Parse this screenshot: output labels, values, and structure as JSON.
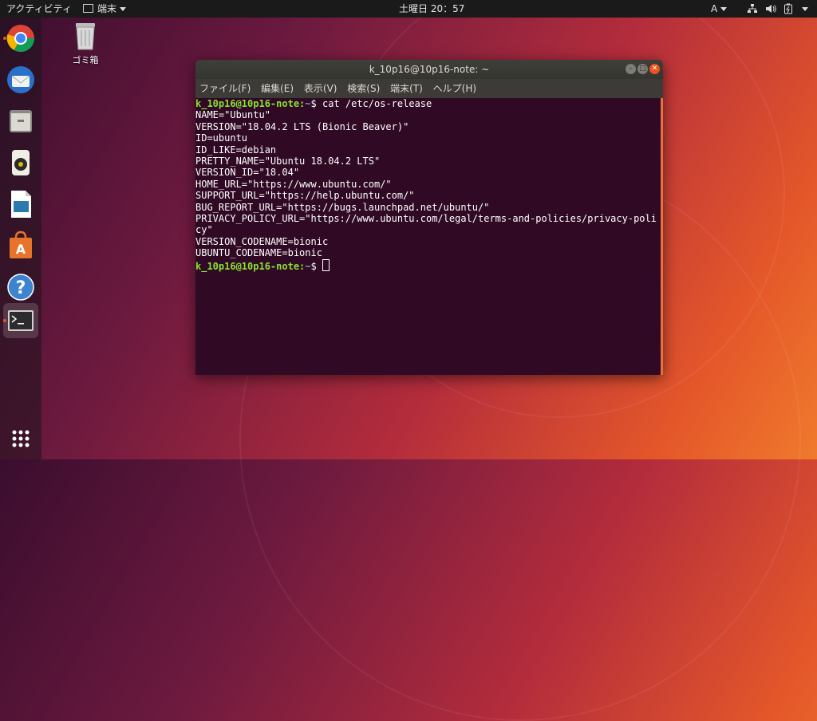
{
  "topbar": {
    "activities": "アクティビティ",
    "app_menu": "端末",
    "clock": "土曜日 20：57",
    "input_method": "A"
  },
  "desktop": {
    "trash_label": "ゴミ箱"
  },
  "dock": {
    "items": [
      "chrome-icon",
      "thunderbird-icon",
      "files-icon",
      "rhythmbox-icon",
      "libreoffice-writer-icon",
      "ubuntu-software-icon",
      "help-icon",
      "terminal-icon"
    ],
    "show_apps": "show-applications-icon"
  },
  "terminal": {
    "title": "k_10p16@10p16-note: ~",
    "menu": [
      "ファイル(F)",
      "編集(E)",
      "表示(V)",
      "検索(S)",
      "端末(T)",
      "ヘルプ(H)"
    ],
    "prompt_user": "k_10p16@10p16-note",
    "prompt_path": "~",
    "command": "cat /etc/os-release",
    "output": [
      "NAME=\"Ubuntu\"",
      "VERSION=\"18.04.2 LTS (Bionic Beaver)\"",
      "ID=ubuntu",
      "ID_LIKE=debian",
      "PRETTY_NAME=\"Ubuntu 18.04.2 LTS\"",
      "VERSION_ID=\"18.04\"",
      "HOME_URL=\"https://www.ubuntu.com/\"",
      "SUPPORT_URL=\"https://help.ubuntu.com/\"",
      "BUG_REPORT_URL=\"https://bugs.launchpad.net/ubuntu/\"",
      "PRIVACY_POLICY_URL=\"https://www.ubuntu.com/legal/terms-and-policies/privacy-poli",
      "cy\"",
      "VERSION_CODENAME=bionic",
      "UBUNTU_CODENAME=bionic"
    ]
  },
  "colors": {
    "accent": "#e95420",
    "terminal_bg": "#300a24",
    "prompt_user": "#8ae234",
    "prompt_path": "#729fcf"
  }
}
